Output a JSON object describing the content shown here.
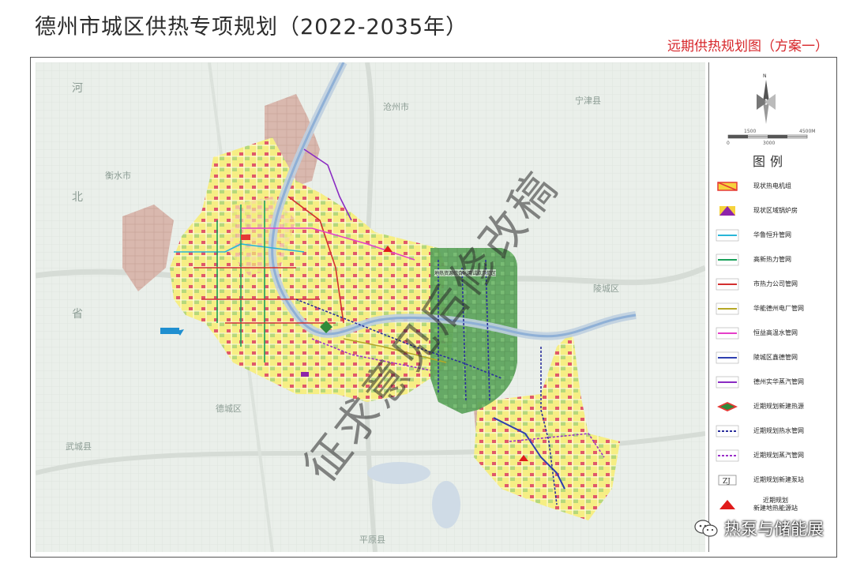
{
  "header": {
    "title": "德州市城区供热专项规划（2022-2035年）",
    "subtitle": "远期供热规划图（方案一）"
  },
  "map": {
    "places": [
      {
        "name": "宁津县"
      },
      {
        "name": "沧州市"
      },
      {
        "name": "衡水市"
      },
      {
        "name": "陵城区"
      },
      {
        "name": "德城区"
      },
      {
        "name": "武城县"
      },
      {
        "name": "平原县"
      }
    ],
    "vertical_labels": [
      "河",
      "北",
      "省"
    ],
    "zone_label": "地热资源综合利用试点示范区",
    "watermark": "征求意见后修改稿"
  },
  "legend": {
    "compass_letter": "N",
    "scale_top": [
      "1500",
      "4500M"
    ],
    "scale_bottom": [
      "0",
      "3000"
    ],
    "heading": "图例",
    "items": [
      {
        "label": "现状热电机组",
        "symbol": "existing-chp",
        "color": "#e53935"
      },
      {
        "label": "现状区域锅炉房",
        "symbol": "existing-boiler",
        "color": "#8e24aa"
      },
      {
        "label": "华鲁恒升管网",
        "symbol": "line",
        "color": "#29b6d8"
      },
      {
        "label": "高新热力管网",
        "symbol": "line",
        "color": "#1aa15a"
      },
      {
        "label": "市热力公司管网",
        "symbol": "line",
        "color": "#d32f2f"
      },
      {
        "label": "华能德州电厂管网",
        "symbol": "line",
        "color": "#b5a826"
      },
      {
        "label": "恒益高温水管网",
        "symbol": "line",
        "color": "#e53fc8"
      },
      {
        "label": "陵城区鑫德管网",
        "symbol": "line",
        "color": "#2e3fb0"
      },
      {
        "label": "德州实华蒸汽管网",
        "symbol": "line",
        "color": "#8a2bc2"
      },
      {
        "label": "近期规划新建热源",
        "symbol": "new-source",
        "color": "#2e8b3a"
      },
      {
        "label": "近期规划热水管网",
        "symbol": "dashed",
        "color": "#2b2f9c"
      },
      {
        "label": "近期规划蒸汽管网",
        "symbol": "dashed",
        "color": "#9b30c8"
      },
      {
        "label": "近期规划新建泵站",
        "symbol": "zj",
        "color": "#333333",
        "text": "ZJ"
      },
      {
        "label": "近期规划\n新建地热能源站",
        "symbol": "triangle",
        "color": "#e01b1b"
      }
    ]
  },
  "brand": {
    "text": "热泵与储能展"
  }
}
